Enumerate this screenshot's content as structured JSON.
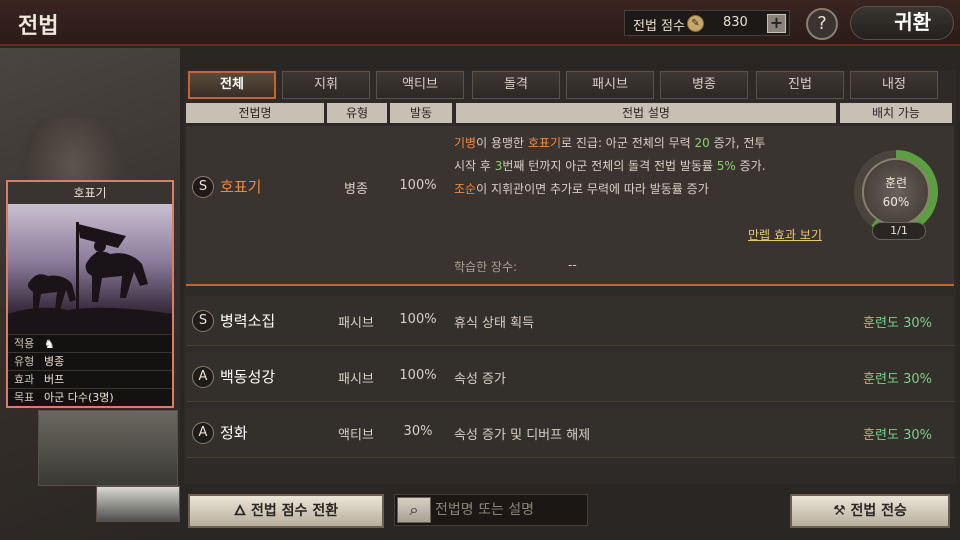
{
  "header": {
    "title": "전법",
    "score_label": "전법 점수",
    "score_value": "830",
    "plus_label": "+",
    "help_label": "?",
    "return_label": "귀환"
  },
  "card": {
    "name": "호표기",
    "rows": [
      {
        "key": "적용",
        "value": ""
      },
      {
        "key": "유형",
        "value": "병종"
      },
      {
        "key": "효과",
        "value": "버프"
      },
      {
        "key": "목표",
        "value": "아군 다수(3명)"
      }
    ]
  },
  "tabs": [
    {
      "label": "전체",
      "active": true
    },
    {
      "label": "지휘",
      "active": false
    },
    {
      "label": "액티브",
      "active": false
    },
    {
      "label": "돌격",
      "active": false
    },
    {
      "label": "패시브",
      "active": false
    },
    {
      "label": "병종",
      "active": false
    },
    {
      "label": "진법",
      "active": false
    },
    {
      "label": "내정",
      "active": false
    }
  ],
  "columns": {
    "name": "전법명",
    "type": "유형",
    "rate": "발동",
    "desc": "전법 설명",
    "deploy": "배치 가능"
  },
  "selected_skill": {
    "grade": "S",
    "name": "호표기",
    "type": "병종",
    "rate": "100%",
    "desc_parts": {
      "p1": "기병",
      "p2": "이 용맹한 ",
      "p3": "호표기",
      "p4": "로 진급: 아군 전체의 무력 ",
      "p5": "20",
      "p6": " 증가, 전투",
      "p7": "시작 후 ",
      "p8": "3",
      "p9": "번째 턴까지 아군 전체의 돌격 전법 발동률 ",
      "p10": "5%",
      "p11": " 증가.",
      "p12": "조순",
      "p13": "이 지휘관이면 추가로 무력에 따라 발동률 증가"
    },
    "training_label": "훈련",
    "training_value": "60%",
    "training_fraction": 0.6,
    "count": "1/1",
    "max_link": "만렙 효과 보기",
    "learned_label": "학습한 장수:",
    "learned_value": "--"
  },
  "skills": [
    {
      "grade": "S",
      "name": "병력소집",
      "type": "패시브",
      "rate": "100%",
      "desc": "휴식 상태 획득",
      "deploy": "훈련도 30%"
    },
    {
      "grade": "A",
      "name": "백동성강",
      "type": "패시브",
      "rate": "100%",
      "desc": "속성 증가",
      "deploy": "훈련도 30%"
    },
    {
      "grade": "A",
      "name": "정화",
      "type": "액티브",
      "rate": "30%",
      "desc": "속성 증가 및 디버프 해제",
      "deploy": "훈련도 30%"
    }
  ],
  "bottom": {
    "convert_label": "전법 점수 전환",
    "search_placeholder": "전법명 또는 설명",
    "inherit_label": "전법 전승"
  },
  "colors": {
    "accent": "#c8642c",
    "deploy_green": "#7ad08a",
    "highlight_orange": "#f08a3a",
    "highlight_green": "#8ad06a"
  }
}
